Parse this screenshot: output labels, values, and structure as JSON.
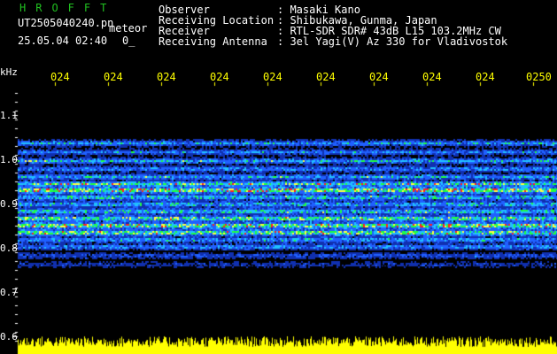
{
  "header": {
    "brand": "HROFFT",
    "filename": "UT2505040240.pn",
    "meteor_label": "meteor",
    "timestamp": "25.05.04 02:40",
    "count": "0_",
    "fields": [
      {
        "label": "Observer",
        "value": ": Masaki Kano"
      },
      {
        "label": "Receiving Location",
        "value": ": Shibukawa, Gunma, Japan"
      },
      {
        "label": "Receiver",
        "value": ": RTL-SDR SDR# 43dB L15 103.2MHz CW"
      },
      {
        "label": "Receiving Antenna",
        "value": ": 3el Yagi(V) Az 330 for Vladivostok"
      }
    ]
  },
  "axes": {
    "y_unit": "kHz",
    "y_ticks": [
      "1.1",
      "1.0",
      "0.9",
      "0.8",
      "0.7",
      "0.6"
    ],
    "x_ticks": [
      "024",
      "024",
      "024",
      "024",
      "024",
      "024",
      "024",
      "024",
      "024",
      "0250"
    ]
  },
  "colors": {
    "background": "#000000",
    "text": "#ffffff",
    "brand": "#20c020",
    "tick_labels": "#ffff00",
    "noise_bar": "#ffff00"
  }
}
